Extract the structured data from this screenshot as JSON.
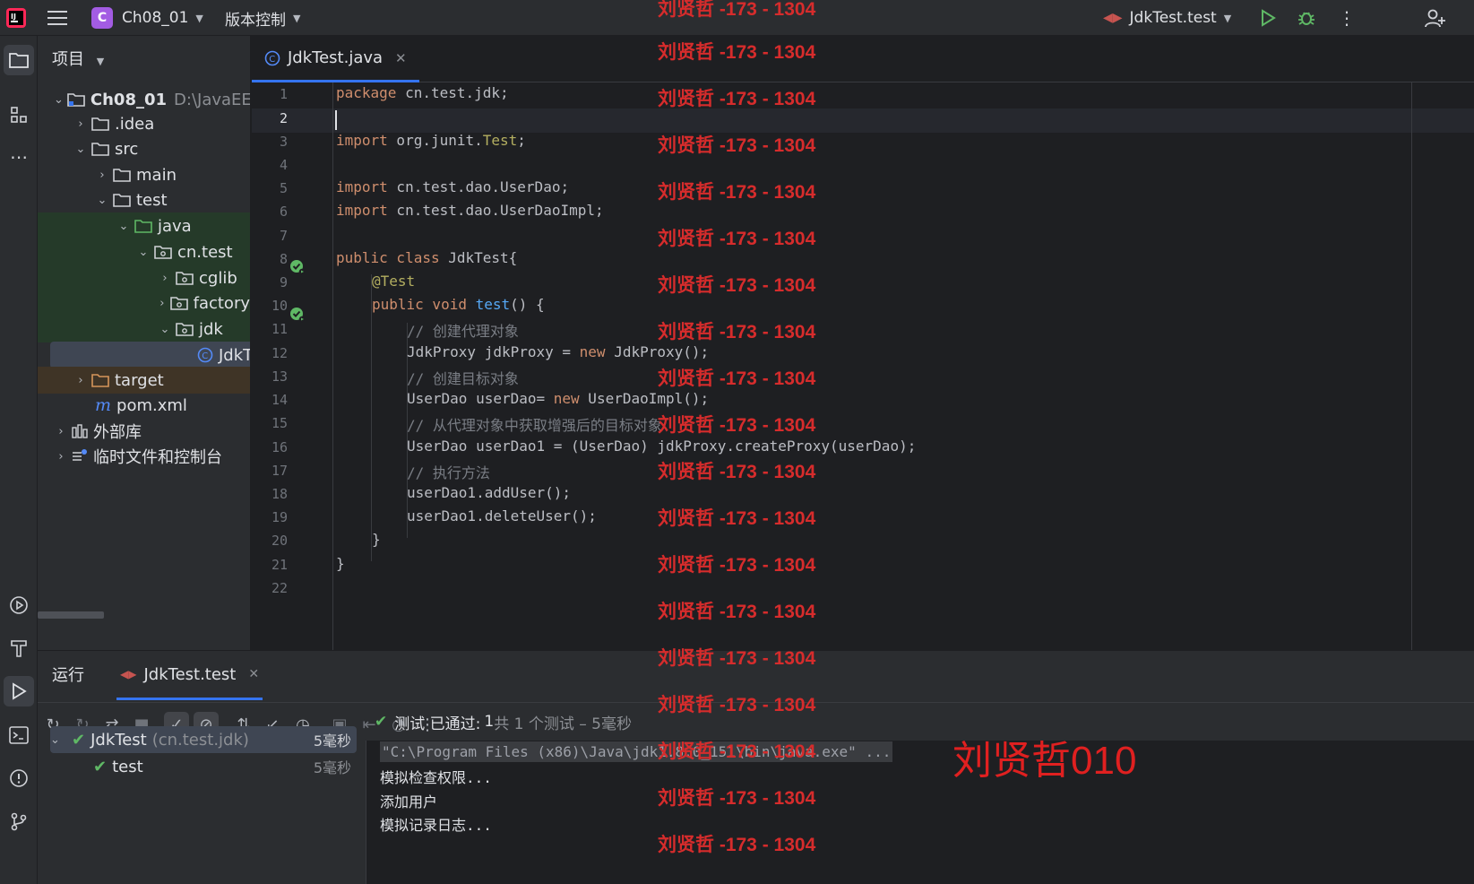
{
  "topbar": {
    "project_badge": "C",
    "project_name": "Ch08_01",
    "vcs_label": "版本控制",
    "run_config": "JdkTest.test"
  },
  "project_panel": {
    "title": "项目",
    "tree": [
      {
        "label": "Ch08_01",
        "suffix": "D:\\JavaEE"
      },
      {
        "label": ".idea"
      },
      {
        "label": "src"
      },
      {
        "label": "main"
      },
      {
        "label": "test"
      },
      {
        "label": "java"
      },
      {
        "label": "cn.test"
      },
      {
        "label": "cglib"
      },
      {
        "label": "factory"
      },
      {
        "label": "jdk"
      },
      {
        "label": "JdkTest"
      },
      {
        "label": "target"
      },
      {
        "label": "pom.xml"
      },
      {
        "label": "外部库"
      },
      {
        "label": "临时文件和控制台"
      }
    ]
  },
  "editor": {
    "tab_label": "JdkTest.java",
    "line_numbers": [
      "1",
      "2",
      "3",
      "4",
      "5",
      "6",
      "7",
      "8",
      "9",
      "10",
      "11",
      "12",
      "13",
      "14",
      "15",
      "16",
      "17",
      "18",
      "19",
      "20",
      "21",
      "22"
    ],
    "lines": {
      "l1": [
        "package",
        " cn.test.jdk;"
      ],
      "l3": [
        "import",
        " org.junit.",
        "Test",
        ";"
      ],
      "l5": [
        "import",
        " cn.test.dao.UserDao;"
      ],
      "l6": [
        "import",
        " cn.test.dao.UserDaoImpl;"
      ],
      "l8": [
        "public class",
        " JdkTest{"
      ],
      "l9": "@Test",
      "l10": [
        "public void",
        " ",
        "test",
        "() {"
      ],
      "l11": "// 创建代理对象",
      "l12": [
        "JdkProxy jdkProxy = ",
        "new",
        " JdkProxy();"
      ],
      "l13": "// 创建目标对象",
      "l14": [
        "UserDao userDao= ",
        "new",
        " UserDaoImpl();"
      ],
      "l15": "// 从代理对象中获取增强后的目标对象",
      "l16": "UserDao userDao1 = (UserDao) jdkProxy.createProxy(userDao);",
      "l17": "// 执行方法",
      "l18": "userDao1.addUser();",
      "l19": "userDao1.deleteUser();",
      "l20": "}",
      "l21": "}"
    }
  },
  "run_panel": {
    "tab_run": "运行",
    "tab_config": "JdkTest.test",
    "tree": [
      {
        "label": "JdkTest",
        "detail": "(cn.test.jdk)",
        "time": "5毫秒"
      },
      {
        "label": "test",
        "time": "5毫秒"
      }
    ],
    "status": {
      "prefix": "测试 已通过:",
      "count": "1",
      "rest": "共 1 个测试 – 5毫秒"
    },
    "console": [
      "\"C:\\Program Files (x86)\\Java\\jdk1.8.0_151\\bin\\java.exe\" ...",
      "模拟检查权限...",
      "添加用户",
      "模拟记录日志..."
    ]
  },
  "watermark": {
    "text": "刘贤哲 -173 - 1304",
    "big": "刘贤哲010"
  },
  "colors": {
    "accent": "#3574f0",
    "keyword": "#cf8e6d",
    "annotation": "#b3ae60",
    "function": "#56a8f5",
    "comment": "#7a7e85",
    "success": "#5fb865",
    "watermark": "#d62c2c"
  }
}
